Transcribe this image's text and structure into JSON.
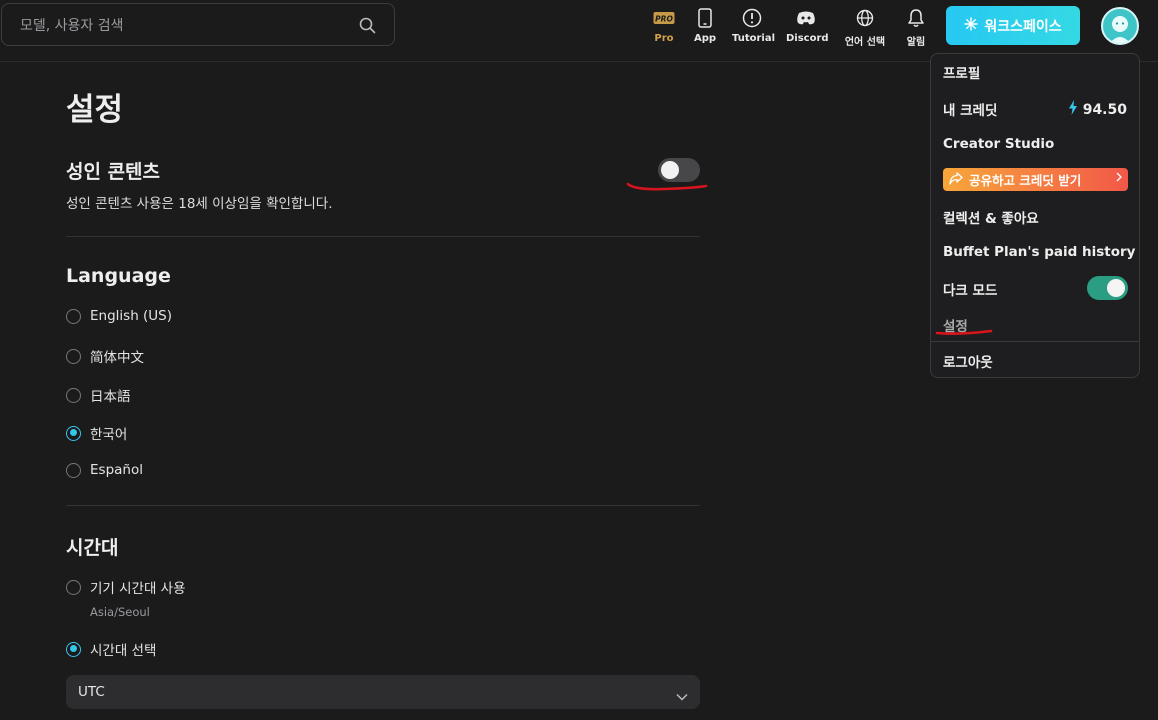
{
  "search": {
    "placeholder": "모델, 사용자 검색",
    "icon": "search-icon"
  },
  "nav": {
    "pro": {
      "label": "Pro",
      "badge": "PRO",
      "color": "#d4a04a"
    },
    "app": {
      "label": "App"
    },
    "tutorial": {
      "label": "Tutorial"
    },
    "discord": {
      "label": "Discord"
    },
    "language": {
      "label": "언어 선택"
    },
    "alerts": {
      "label": "알림"
    },
    "workspace": {
      "label": "워크스페이스"
    }
  },
  "page": {
    "title": "설정"
  },
  "adult": {
    "title": "성인 콘텐츠",
    "description": "성인 콘텐츠 사용은 18세 이상임을 확인합니다.",
    "enabled": false
  },
  "language": {
    "title": "Language",
    "options": [
      "English (US)",
      "简体中文",
      "日本語",
      "한국어",
      "Español"
    ],
    "selected": "한국어"
  },
  "timezone": {
    "title": "시간대",
    "device_option": "기기 시간대 사용",
    "device_tz": "Asia/Seoul",
    "select_option": "시간대 선택",
    "selected_option": "시간대 선택",
    "select_value": "UTC"
  },
  "menu": {
    "profile": "프로필",
    "credits_label": "내 크레딧",
    "credits_value": "94.50",
    "creator_studio": "Creator Studio",
    "share": "공유하고 크레딧 받기",
    "collections": "컬렉션 & 좋아요",
    "buffet": "Buffet Plan's paid history",
    "dark_mode": "다크 모드",
    "dark_mode_on": true,
    "settings": "설정",
    "logout": "로그아웃"
  },
  "colors": {
    "accent": "#36c6ec",
    "background": "#1b1b1c",
    "toggle_on": "#2a9d82",
    "annotation": "#d9141c"
  }
}
